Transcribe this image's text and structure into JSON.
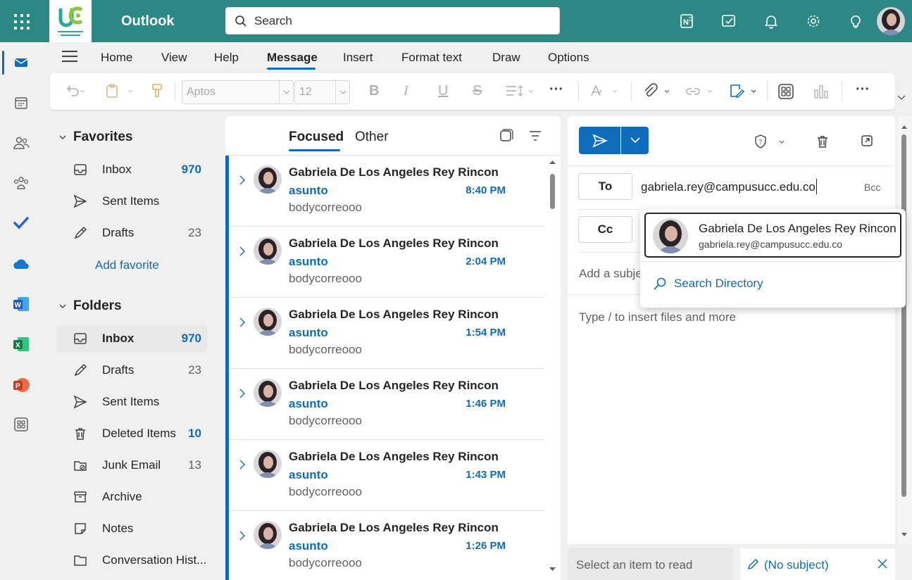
{
  "header": {
    "app_title": "Outlook",
    "search_placeholder": "Search",
    "accent_color": "#2b8885"
  },
  "ribbon": {
    "tabs": [
      "Home",
      "View",
      "Help",
      "Message",
      "Insert",
      "Format text",
      "Draw",
      "Options"
    ],
    "active_tab": "Message",
    "font_name": "Aptos",
    "font_size": "12",
    "bold_label": "B",
    "italic_label": "I",
    "underline_label": "U",
    "strike_label": "S",
    "more_label": "···"
  },
  "folders": {
    "favorites_header": "Favorites",
    "favorites": [
      {
        "label": "Inbox",
        "count": "970",
        "icon": "inbox-icon"
      },
      {
        "label": "Sent Items",
        "count": "",
        "icon": "send-icon"
      },
      {
        "label": "Drafts",
        "count": "23",
        "icon": "draft-icon"
      }
    ],
    "add_favorite": "Add favorite",
    "folders_header": "Folders",
    "items": [
      {
        "label": "Inbox",
        "count": "970",
        "icon": "inbox-icon"
      },
      {
        "label": "Drafts",
        "count": "23",
        "icon": "draft-icon"
      },
      {
        "label": "Sent Items",
        "count": "",
        "icon": "send-icon"
      },
      {
        "label": "Deleted Items",
        "count": "10",
        "icon": "trash-icon"
      },
      {
        "label": "Junk Email",
        "count": "13",
        "icon": "junk-icon"
      },
      {
        "label": "Archive",
        "count": "",
        "icon": "archive-icon"
      },
      {
        "label": "Notes",
        "count": "",
        "icon": "note-icon"
      },
      {
        "label": "Conversation Hist...",
        "count": "",
        "icon": "folder-icon"
      }
    ]
  },
  "message_list": {
    "tab_focused": "Focused",
    "tab_other": "Other",
    "messages": [
      {
        "from": "Gabriela De Los Angeles Rey Rincon",
        "subject": "asunto",
        "time": "8:40 PM",
        "preview": "bodycorreooo"
      },
      {
        "from": "Gabriela De Los Angeles Rey Rincon",
        "subject": "asunto",
        "time": "2:04 PM",
        "preview": "bodycorreooo"
      },
      {
        "from": "Gabriela De Los Angeles Rey Rincon",
        "subject": "asunto",
        "time": "1:54 PM",
        "preview": "bodycorreooo"
      },
      {
        "from": "Gabriela De Los Angeles Rey Rincon",
        "subject": "asunto",
        "time": "1:46 PM",
        "preview": "bodycorreooo"
      },
      {
        "from": "Gabriela De Los Angeles Rey Rincon",
        "subject": "asunto",
        "time": "1:43 PM",
        "preview": "bodycorreooo"
      },
      {
        "from": "Gabriela De Los Angeles Rey Rincon",
        "subject": "asunto",
        "time": "1:26 PM",
        "preview": "bodycorreooo"
      }
    ]
  },
  "compose": {
    "to_label": "To",
    "cc_label": "Cc",
    "bcc_label": "Bcc",
    "to_value": "gabriela.rey@campusucc.edu.co",
    "subject_placeholder": "Add a subje",
    "body_placeholder": "Type / to insert files and more",
    "suggestion": {
      "name": "Gabriela De Los Angeles Rey Rincon",
      "email": "gabriela.rey@campusucc.edu.co",
      "search_directory": "Search Directory"
    }
  },
  "bottom": {
    "read_label": "Select an item to read",
    "draft_tab_label": "(No subject)"
  }
}
